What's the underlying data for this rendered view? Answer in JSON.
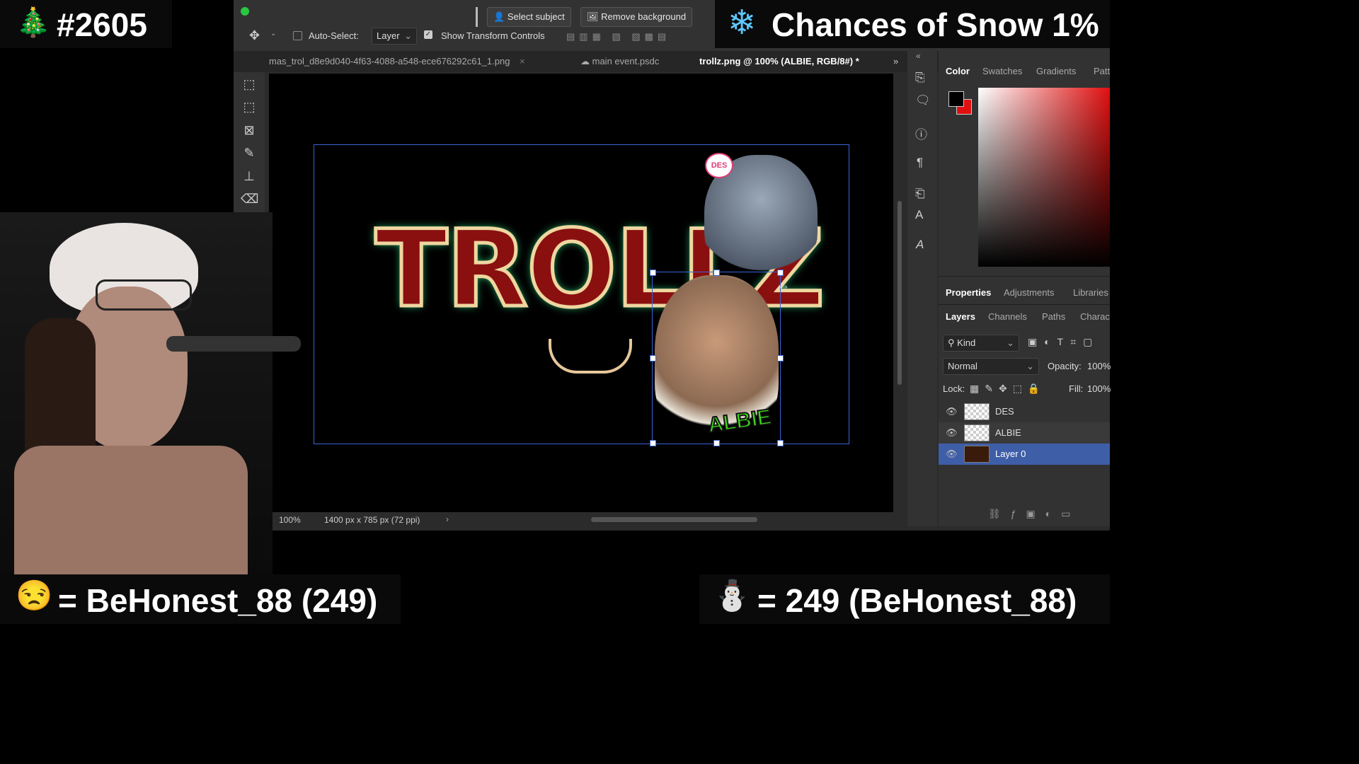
{
  "overlay": {
    "stream_number": "#2605",
    "tree_emoji": "🎄",
    "snow_text": "Chances of Snow 1%",
    "snow_icon": "❄",
    "left_bottom": "= BeHonest_88 (249)",
    "left_emoji": "😒",
    "right_bottom": "= 249 (BeHonest_88)",
    "right_emoji": "⛄"
  },
  "options_bar": {
    "auto_select_label": "Auto-Select:",
    "auto_select_value": "Layer",
    "show_transform_label": "Show Transform Controls",
    "select_subject": "Select subject",
    "remove_background": "Remove background"
  },
  "tabs": [
    {
      "label": "mas_trol_d8e9d040-4f63-4088-a548-ece676292c61_1.png"
    },
    {
      "label": "main event.psdc"
    },
    {
      "label": "trollz.png @ 100% (ALBIE, RGB/8#) *"
    }
  ],
  "status": {
    "zoom": "100%",
    "doc_size": "1400 px x 785 px (72 ppi)"
  },
  "canvas": {
    "title_text": "TROLLZ",
    "bubble_text": "DES",
    "albie_text": "ALBIE"
  },
  "color_panel": {
    "tabs": [
      "Color",
      "Swatches",
      "Gradients",
      "Patt"
    ]
  },
  "properties_panel": {
    "tabs": [
      "Properties",
      "Adjustments",
      "Libraries"
    ]
  },
  "layers_panel": {
    "tabs": [
      "Layers",
      "Channels",
      "Paths",
      "Charac"
    ],
    "kind": "Kind",
    "blend_mode": "Normal",
    "opacity_label": "Opacity:",
    "opacity_value": "100%",
    "lock_label": "Lock:",
    "fill_label": "Fill:",
    "fill_value": "100%",
    "layers": [
      {
        "name": "DES",
        "selected": false
      },
      {
        "name": "ALBIE",
        "selected": false
      },
      {
        "name": "Layer 0",
        "selected": true
      }
    ]
  },
  "colors": {
    "accent_blue": "#3e5ea8",
    "foreground": "#000000",
    "background": "#e01010"
  }
}
